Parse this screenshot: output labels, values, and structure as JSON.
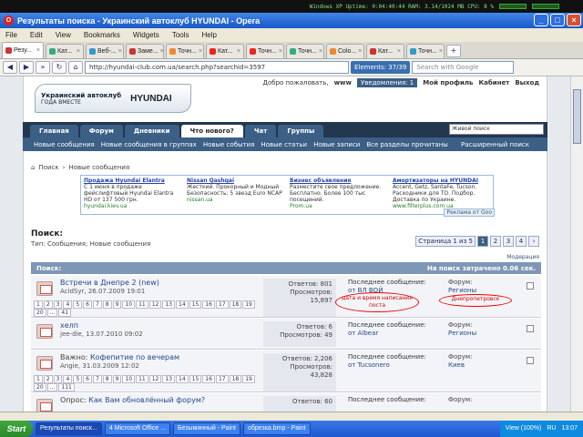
{
  "system_bar": {
    "text": "Windows XP  Uptime:  0:04:40:44  RAM:  3.14/1024 MB  CPU:  8 %"
  },
  "window": {
    "title": "Результаты поиска - Украинский автоклуб HYUNDAI - Opera"
  },
  "menu": [
    "File",
    "Edit",
    "View",
    "Bookmarks",
    "Widgets",
    "Tools",
    "Help"
  ],
  "tabs": [
    {
      "label": "Резу...",
      "color": "#c33"
    },
    {
      "label": "Кат...",
      "color": "#3a8"
    },
    {
      "label": "Веб-...",
      "color": "#39c"
    },
    {
      "label": "Заме...",
      "color": "#c33"
    },
    {
      "label": "Точн...",
      "color": "#e83"
    },
    {
      "label": "Кат...",
      "color": "#e22"
    },
    {
      "label": "Точн...",
      "color": "#e22"
    },
    {
      "label": "Точн...",
      "color": "#3a8"
    },
    {
      "label": "Colo...",
      "color": "#e83"
    },
    {
      "label": "Кат...",
      "color": "#c33"
    },
    {
      "label": "Точн...",
      "color": "#39c"
    }
  ],
  "nav": {
    "url": "http://hyundai-club.com.ua/search.php?searchid=3597",
    "elements": "Elements: 37/39",
    "search_placeholder": "Search with Google"
  },
  "site": {
    "logo_line1": "Украинский автоклуб",
    "logo_line2": "ГОДА ВМЕСТЕ",
    "logo_brand": "HYUNDAI",
    "welcome": "Добро пожаловать,",
    "username": "www",
    "notifications": "Уведомления: 1",
    "profile": "Мой профиль",
    "cabinet": "Кабинет",
    "logout": "Выход",
    "main_tabs": [
      "Главная",
      "Форум",
      "Дневники",
      "Что нового?",
      "Чат",
      "Группы"
    ],
    "search_box": "Живой поиск",
    "sub_nav": [
      "Новые сообщения",
      "Новые сообщения в группах",
      "Новые события",
      "Новые статьи",
      "Новые записи",
      "Все разделы прочитаны"
    ],
    "advanced_search": "Расширенный поиск"
  },
  "breadcrumb": [
    "Поиск",
    "Новые сообщения"
  ],
  "ads": [
    {
      "title": "Продажа Hyundai Elantra",
      "text": "С 1 июня в продаже фейслифтовый Hyundai Elantra HD от 137 500 грн.",
      "url": "hyundai.kiev.ua"
    },
    {
      "title": "Nissan Qashqai",
      "text": "Жесткий. Прокорный и Модный Безопасность: 5 звезд Euro NCAP",
      "url": "nissan.ua"
    },
    {
      "title": "Бизнес объявления",
      "text": "Разместите свое предложение. Бесплатно. Более 100 тыс посещений.",
      "url": "Prom.ua"
    },
    {
      "title": "Амортизаторы на HYUNDAI",
      "text": "Accent, Getz, SantaFe, Tucson. Расходники для ТО. Подбор. Доставка по Украине.",
      "url": "www.filterplus.com.ua"
    }
  ],
  "ads_tag": "Реклама от Goo",
  "results": {
    "title": "Поиск:",
    "description": "Тип: Сообщения; Новые сообщения",
    "pager_label": "Страница 1 из 5",
    "pages": [
      "1",
      "2",
      "3",
      "4"
    ],
    "moderation": "Модерация",
    "list_header": "Поиск:",
    "list_time": "На поиск затрачено 0.06 сек."
  },
  "threads": [
    {
      "prefix": "",
      "title": "Встречи в Днепре 2 (new)",
      "author": "AcidSyr",
      "date": "26.07.2009 19:01",
      "replies": "Ответов: 801",
      "views_label": "Просмотров:",
      "views": "15,897",
      "last_label": "Последнее сообщение:",
      "last_by": "от ВЛ ВОЙ",
      "forum_label": "Форум:",
      "forum": "Регионы",
      "pages": [
        "1",
        "2",
        "3",
        "4",
        "5",
        "6",
        "7",
        "8",
        "9",
        "10",
        "11",
        "12",
        "13",
        "14",
        "15",
        "16",
        "17",
        "18",
        "19"
      ],
      "pages2": [
        "20",
        "...",
        "41"
      ]
    },
    {
      "prefix": "",
      "title": "хелп",
      "author": "jee-die",
      "date": "13.07.2010 09:02",
      "replies": "Ответов: 6",
      "views_label": "Просмотров:",
      "views": "49",
      "last_label": "Последнее сообщение:",
      "last_by": "от Albear",
      "forum_label": "Форум:",
      "forum": "Регионы",
      "pages": [],
      "pages2": []
    },
    {
      "prefix": "Важно:",
      "title": "Кофепитие по вечерам",
      "author": "Angie",
      "date": "31.03.2009 12:02",
      "replies": "Ответов: 2,206",
      "views_label": "Просмотров:",
      "views": "43,828",
      "last_label": "Последнее сообщение:",
      "last_by": "от Tucsonero",
      "forum_label": "Форум:",
      "forum": "Киев",
      "pages": [
        "1",
        "2",
        "3",
        "4",
        "5",
        "6",
        "7",
        "8",
        "9",
        "10",
        "11",
        "12",
        "13",
        "14",
        "15",
        "16",
        "17",
        "18",
        "19"
      ],
      "pages2": [
        "20",
        "...",
        "111"
      ]
    },
    {
      "prefix": "Опрос:",
      "title": "Как Вам обновлённый форум?",
      "author": "",
      "date": "",
      "replies": "Ответов: 60",
      "views_label": "",
      "views": "",
      "last_label": "Последнее сообщение:",
      "last_by": "",
      "forum_label": "Форум:",
      "forum": "",
      "pages": [],
      "pages2": []
    }
  ],
  "annotations": {
    "left": "дата и время написания поста",
    "right": "Днепропетровск"
  },
  "status_text": "",
  "taskbar": {
    "start": "Start",
    "buttons": [
      "Результаты поиск...",
      "4 Microsoft Office ...",
      "Безымянный - Paint",
      "обрезка.bmp - Paint"
    ],
    "lang": "RU",
    "clock": "13:07",
    "view": "View (100%)"
  }
}
